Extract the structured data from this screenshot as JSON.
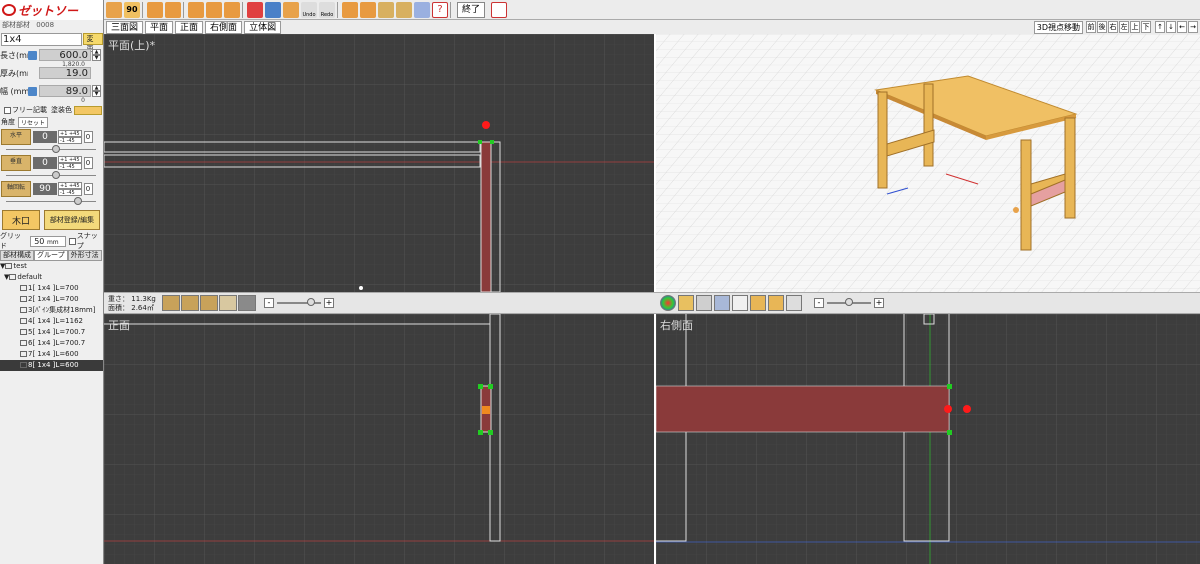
{
  "app": {
    "logo_text": "ゼットソー",
    "part_label": "部材部材",
    "part_code": "0008",
    "part_name": "1x4",
    "change_btn": "変更"
  },
  "dims": {
    "length_label": "長さ(mm)",
    "length_value": "600.0",
    "length_sub": "1,820.0",
    "thickness_label": "厚み(mm)",
    "thickness_value": "19.0",
    "width_label": "幅 (mm)",
    "width_value": "89.0",
    "width_sub": "0"
  },
  "options": {
    "free_label": "フリー記載",
    "paint_label": "塗装色",
    "angle_label": "角度",
    "reset_btn": "リセット"
  },
  "rotation": [
    {
      "label": "水平",
      "value": "0",
      "plus": "+1 +45",
      "minus": "-1 -45",
      "zero": "0"
    },
    {
      "label": "垂直",
      "value": "0",
      "plus": "+1 +45",
      "minus": "-1 -45",
      "zero": "0"
    },
    {
      "label": "軸回転",
      "value": "90",
      "plus": "+1 +45",
      "minus": "-1 -45",
      "zero": "0"
    }
  ],
  "actions": {
    "kiguchi": "木口",
    "register": "部材登録/編集"
  },
  "grid": {
    "label": "グリッド",
    "value": "50",
    "unit": "mm",
    "snap": "スナップ"
  },
  "tree_tabs": [
    "部材構成",
    "グループ",
    "外形寸法"
  ],
  "tree": {
    "root": "test",
    "group": "default",
    "items": [
      "1[ 1x4 ]L=700",
      "2[ 1x4 ]L=700",
      "3[ﾊﾟｲﾝ集成材18mm]",
      "4[ 1x4 ]L=1162",
      "5[ 1x4 ]L=700.7",
      "6[ 1x4 ]L=700.7",
      "7[ 1x4 ]L=600",
      "8[ 1x4 ]L=600"
    ],
    "selected_index": 7
  },
  "toolbar": {
    "rotate90": "90",
    "undo": "Undo",
    "redo": "Redo",
    "quit": "終了"
  },
  "view_tabs": [
    "三面図",
    "平面",
    "正面",
    "右側面",
    "立体図"
  ],
  "nav3d": {
    "label": "3D視点移動",
    "buttons": [
      "前",
      "後",
      "右",
      "左",
      "上",
      "下"
    ],
    "arrows": [
      "↑",
      "↓",
      "←",
      "→"
    ]
  },
  "viewports": {
    "top": "平面(上)*",
    "front": "正面",
    "right": "右側面"
  },
  "status": {
    "weight_label": "重さ：",
    "weight_value": "11.3Kg",
    "area_label": "面積：",
    "area_value": "2.64㎡",
    "zoom_minus": "-",
    "zoom_plus": "+"
  },
  "colors": {
    "part_fill": "#8a3a3a",
    "wood": "#e8b656",
    "marker_red": "#ff1a1a",
    "marker_green": "#22cc22"
  }
}
